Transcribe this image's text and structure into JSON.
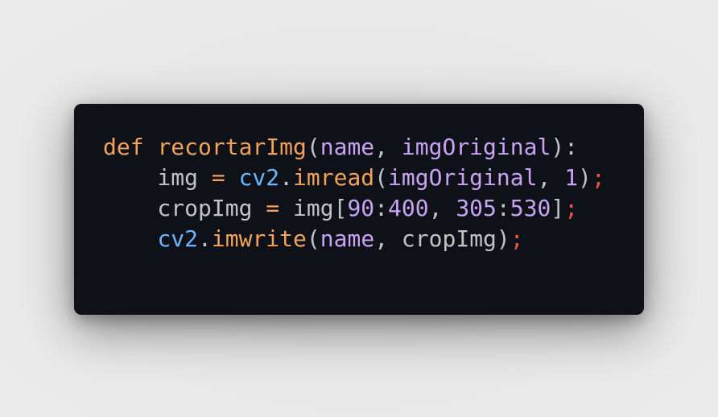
{
  "code": {
    "lines": [
      [
        {
          "t": "def",
          "c": "kw"
        },
        {
          "t": " ",
          "c": "plain"
        },
        {
          "t": "recortarImg",
          "c": "fn"
        },
        {
          "t": "(",
          "c": "plain"
        },
        {
          "t": "name",
          "c": "pn"
        },
        {
          "t": ", ",
          "c": "plain"
        },
        {
          "t": "imgOriginal",
          "c": "pn"
        },
        {
          "t": "):",
          "c": "plain"
        }
      ],
      [
        {
          "t": "    img ",
          "c": "plain"
        },
        {
          "t": "=",
          "c": "op"
        },
        {
          "t": " ",
          "c": "plain"
        },
        {
          "t": "cv2",
          "c": "mod"
        },
        {
          "t": ".",
          "c": "plain"
        },
        {
          "t": "imread",
          "c": "fn"
        },
        {
          "t": "(",
          "c": "plain"
        },
        {
          "t": "imgOriginal",
          "c": "pn"
        },
        {
          "t": ", ",
          "c": "plain"
        },
        {
          "t": "1",
          "c": "num"
        },
        {
          "t": ")",
          "c": "plain"
        },
        {
          "t": ";",
          "c": "semi"
        }
      ],
      [
        {
          "t": "    cropImg ",
          "c": "plain"
        },
        {
          "t": "=",
          "c": "op"
        },
        {
          "t": " img[",
          "c": "plain"
        },
        {
          "t": "90",
          "c": "num"
        },
        {
          "t": ":",
          "c": "plain"
        },
        {
          "t": "400",
          "c": "num"
        },
        {
          "t": ", ",
          "c": "plain"
        },
        {
          "t": "305",
          "c": "num"
        },
        {
          "t": ":",
          "c": "plain"
        },
        {
          "t": "530",
          "c": "num"
        },
        {
          "t": "]",
          "c": "plain"
        },
        {
          "t": ";",
          "c": "semi"
        }
      ],
      [
        {
          "t": "    ",
          "c": "plain"
        },
        {
          "t": "cv2",
          "c": "mod"
        },
        {
          "t": ".",
          "c": "plain"
        },
        {
          "t": "imwrite",
          "c": "fn"
        },
        {
          "t": "(",
          "c": "plain"
        },
        {
          "t": "name",
          "c": "pn"
        },
        {
          "t": ", cropImg)",
          "c": "plain"
        },
        {
          "t": ";",
          "c": "semi"
        }
      ]
    ]
  },
  "colors": {
    "card_background": "#0e1117",
    "page_background": "#e6e6e6",
    "keyword": "#f3a25c",
    "function": "#f3a25c",
    "parameter": "#c9a3f5",
    "module": "#6cb6ff",
    "number": "#c9a3f5",
    "semicolon": "#e5534b",
    "plain": "#c3c3c3"
  }
}
